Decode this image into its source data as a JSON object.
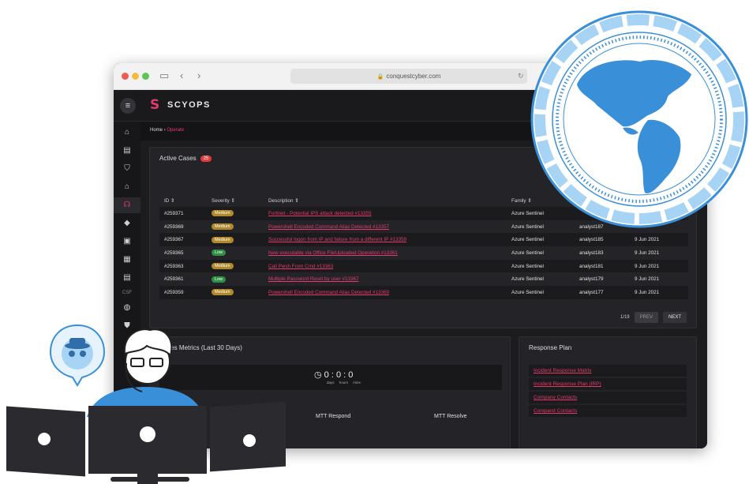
{
  "browser": {
    "url": "conquestcyber.com"
  },
  "app": {
    "brand": "SCYOPS",
    "sidebar_label": "CSF"
  },
  "breadcrumb": {
    "home": "Home",
    "separator": "›",
    "current": "Operate"
  },
  "active_cases": {
    "title": "Active Cases",
    "count": "25",
    "columns": [
      "ID ⇕",
      "Severity ⇕",
      "Description ⇕",
      "Family ⇕"
    ],
    "rows": [
      {
        "id": "#259371",
        "severity": "Medium",
        "description": "Fortinet - Potential IPS attack detected #13355",
        "family": "Azure Sentinel",
        "analyst": "",
        "date": ""
      },
      {
        "id": "#259369",
        "severity": "Medium",
        "description": "Powershell Encoded Command Alias Detected #13357",
        "family": "Azure Sentinel",
        "analyst": "analyst187",
        "date": ""
      },
      {
        "id": "#259367",
        "severity": "Medium",
        "description": "Successful logon from IP and failure from a different IP #13359",
        "family": "Azure Sentinel",
        "analyst": "analyst185",
        "date": "9 Jun 2021"
      },
      {
        "id": "#259365",
        "severity": "Low",
        "description": "New executable via Office FileUploaded Operation #13361",
        "family": "Azure Sentinel",
        "analyst": "analyst183",
        "date": "9 Jun 2021"
      },
      {
        "id": "#259363",
        "severity": "Medium",
        "description": "Call Pwsh From Cmd #13363",
        "family": "Azure Sentinel",
        "analyst": "analyst181",
        "date": "9 Jun 2021"
      },
      {
        "id": "#259361",
        "severity": "Low",
        "description": "Multiple Password Reset by user #13367",
        "family": "Azure Sentinel",
        "analyst": "analyst179",
        "date": "9 Jun 2021"
      },
      {
        "id": "#259359",
        "severity": "Medium",
        "description": "Powershell Encoded Command Alias Detected #13369",
        "family": "Azure Sentinel",
        "analyst": "analyst177",
        "date": "9 Jun 2021"
      }
    ],
    "pager": {
      "page": "1/19",
      "prev": "PREV",
      "next": "NEXT"
    }
  },
  "metrics": {
    "title": "Cases Metrics (Last 30 Days)",
    "clock": "0 : 0 : 0",
    "clock_units": "days hours mins",
    "mtt_respond": "MTT Respond",
    "mtt_resolve": "MTT Resolve"
  },
  "response_plan": {
    "title": "Response Plan",
    "links": [
      "Incident Response Matrix",
      "Incident Response Plan (IRP)",
      "Company Contacts",
      "Conquest Contacts"
    ]
  },
  "colors": {
    "accent": "#e13b6a",
    "medium": "#b08a2a",
    "low": "#2e8f45",
    "globe": "#3a8fd9"
  },
  "icons": [
    "home-icon",
    "server-icon",
    "shield-icon",
    "bank-icon",
    "headset-icon",
    "box-icon",
    "chip-icon",
    "chart-icon",
    "document-icon",
    "globe-icon",
    "check-shield-icon"
  ]
}
